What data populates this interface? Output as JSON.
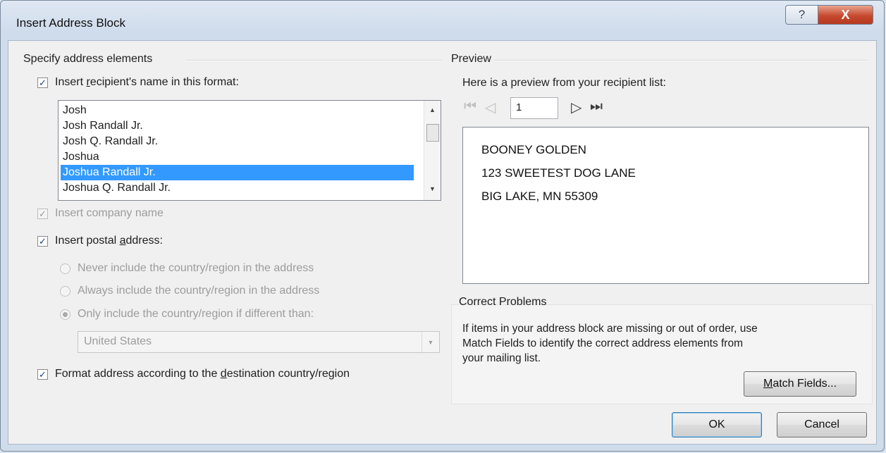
{
  "window": {
    "title": "Insert Address Block",
    "help_label": "?",
    "close_label": "X"
  },
  "left": {
    "group_title": "Specify address elements",
    "name_checkbox": {
      "checked": true,
      "label_pre": "Insert ",
      "label_key": "r",
      "label_post": "ecipient's name in this format:"
    },
    "name_formats": [
      "Josh",
      "Josh Randall Jr.",
      "Josh Q. Randall Jr.",
      "Joshua",
      "Joshua Randall Jr.",
      "Joshua Q. Randall Jr."
    ],
    "selected_format": "Joshua Randall Jr.",
    "company_checkbox": {
      "checked": true,
      "enabled": false,
      "label": "Insert company name"
    },
    "postal_checkbox": {
      "checked": true,
      "label_pre": "Insert postal ",
      "label_key": "a",
      "label_post": "ddress:"
    },
    "country_options": [
      "Never include the country/region in the address",
      "Always include the country/region in the address",
      "Only include the country/region if different than:"
    ],
    "selected_country_option": 2,
    "country_value": "United States",
    "format_checkbox": {
      "checked": true,
      "label_pre": "Format address according to the ",
      "label_key": "d",
      "label_post": "estination country/region"
    }
  },
  "preview": {
    "group_title": "Preview",
    "intro": "Here is a preview from your recipient list:",
    "record": "1",
    "address_lines": [
      "BOONEY GOLDEN",
      "123 SWEETEST DOG LANE",
      "BIG LAKE, MN 55309"
    ]
  },
  "correct_problems": {
    "title": "Correct Problems",
    "text_lines": [
      "If items in your address block are missing or out of order, use",
      "Match Fields to identify the correct address elements from",
      "your mailing list."
    ],
    "match_pre": "",
    "match_key": "M",
    "match_post": "atch Fields..."
  },
  "buttons": {
    "ok": "OK",
    "cancel": "Cancel"
  },
  "icons": {
    "check": "✓",
    "scroll_up": "▲",
    "scroll_down": "▼",
    "dropdown": "▼",
    "first": "⏮",
    "prev": "◁",
    "next": "▷",
    "last": "⏭"
  }
}
